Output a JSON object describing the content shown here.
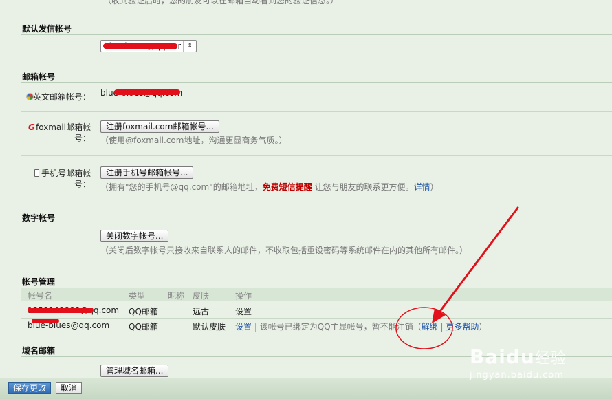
{
  "top_note": "（收到验证后时，您的朋友可以在邮箱自动看到您的验证信息。）",
  "default_sender": {
    "title": "默认发信帐号",
    "selected_value": "blue-blues@qq.com"
  },
  "mail_accounts": {
    "title": "邮箱帐号",
    "english": {
      "label": "英文邮箱帐号：",
      "value": "blue-blues@qq.com"
    },
    "foxmail": {
      "label_line1": "foxmail邮箱帐",
      "label_line2": "号：",
      "button": "注册foxmail.com邮箱帐号...",
      "note": "（使用@foxmail.com地址，沟通更显商务气质。）"
    },
    "mobile": {
      "label_line1": "手机号邮箱帐",
      "label_line2": "号：",
      "button": "注册手机号邮箱帐号...",
      "note_prefix": "（拥有\"您的手机号@qq.com\"的邮箱地址，",
      "note_red": "免费短信提醒",
      "note_mid": " 让您与朋友的联系更方便。",
      "note_link": "详情",
      "note_suffix": "）"
    }
  },
  "digital_account": {
    "title": "数字帐号",
    "button": "关闭数字帐号...",
    "note": "（关闭后数字帐号只接收来自联系人的邮件，不收取包括重设密码等系统邮件在内的其他所有邮件。）"
  },
  "account_management": {
    "title": "帐号管理",
    "headers": [
      "帐号名",
      "类型",
      "昵称",
      "皮肤",
      "操作"
    ],
    "rows": [
      {
        "name": "1358148888@qq.com",
        "type": "QQ邮箱",
        "nickname": "",
        "skin": "远古",
        "action": "设置",
        "note": ""
      },
      {
        "name": "blue-blues@qq.com",
        "type": "QQ邮箱",
        "nickname": "",
        "skin": "默认皮肤",
        "action": "设置",
        "sep": "|",
        "note": "该帐号已绑定为QQ主显帐号，暂不能注销（",
        "unbind": "解绑",
        "sep2": "|",
        "more_help": "更多帮助",
        "close": "）"
      }
    ]
  },
  "domain_mail": {
    "title": "域名邮箱",
    "button": "管理域名邮箱..."
  },
  "footer": {
    "save": "保存更改",
    "cancel": "取消"
  },
  "watermark": {
    "brand": "Baidu",
    "brand_cn": "经验",
    "url": "jingyan.baidu.com"
  },
  "colors": {
    "page_bg": "#e9f1e6",
    "link": "#1f54a6",
    "annotation_red": "#e2101a",
    "primary_button": "#2f6bb4"
  }
}
